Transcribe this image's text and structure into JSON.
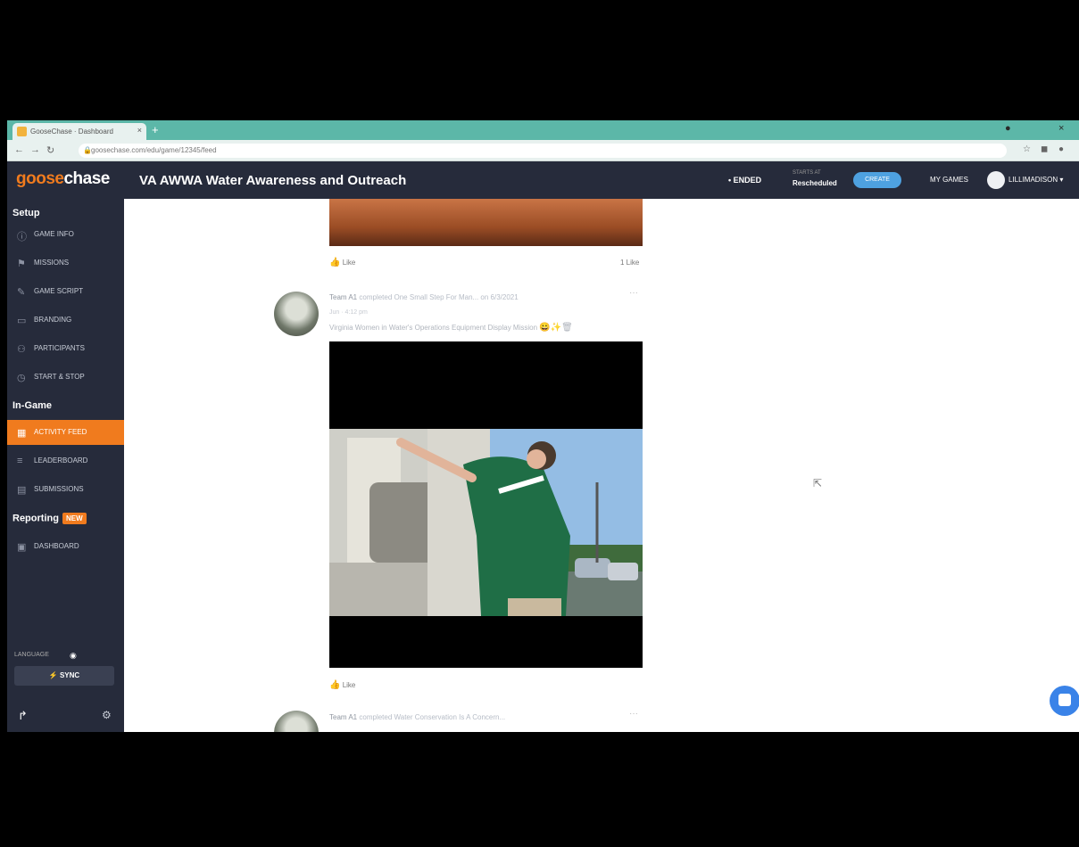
{
  "browser": {
    "tab_title": "GooseChase · Dashboard",
    "tab_close": "×",
    "new_tab": "+",
    "url": "goosechase.com/edu/game/12345/feed",
    "win_minimize": "●",
    "win_close": "×"
  },
  "app": {
    "logo_a": "goose",
    "logo_b": "chase",
    "logo_sub": "",
    "title": "VA AWWA Water Awareness and Outreach",
    "status": "• ENDED",
    "sched_label": "STARTS AT",
    "sched_value": "Rescheduled",
    "header_button": "CREATE",
    "my_games": "MY GAMES",
    "username": "LILLIMADISON ▾"
  },
  "sidebar": {
    "setup_label": "Setup",
    "setup_items": [
      "GAME INFO",
      "MISSIONS",
      "GAME SCRIPT",
      "BRANDING",
      "PARTICIPANTS",
      "START & STOP"
    ],
    "ingame_label": "In-Game",
    "ingame_items": [
      "ACTIVITY FEED",
      "LEADERBOARD",
      "SUBMISSIONS"
    ],
    "reporting_label": "Reporting",
    "reporting_badge": "NEW",
    "reporting_items": [
      "DASHBOARD"
    ],
    "language": "LANGUAGE",
    "sync": "SYNC",
    "icons": {
      "game_info": "info-icon",
      "missions": "flag-icon",
      "script": "script-icon",
      "branding": "brush-icon",
      "participants": "people-icon",
      "start_stop": "clock-icon"
    }
  },
  "feed": {
    "post1": {
      "like": "Like",
      "likes_count": "1 Like"
    },
    "post2": {
      "author": "Team A1",
      "action": "completed One Small Step For Man... on 6/3/2021",
      "time": "Jun · 4:12 pm",
      "caption": "Virginia Women in Water's Operations Equipment Display Mission",
      "emojis": "😀✨🗑",
      "like": "Like"
    },
    "post3": {
      "author": "Team A1",
      "action": "completed Water Conservation Is A Concern..."
    }
  },
  "colors": {
    "accent": "#f07b1e",
    "nav": "#262b3b",
    "chrome": "#5cb7a8",
    "button": "#4ea1e0"
  }
}
